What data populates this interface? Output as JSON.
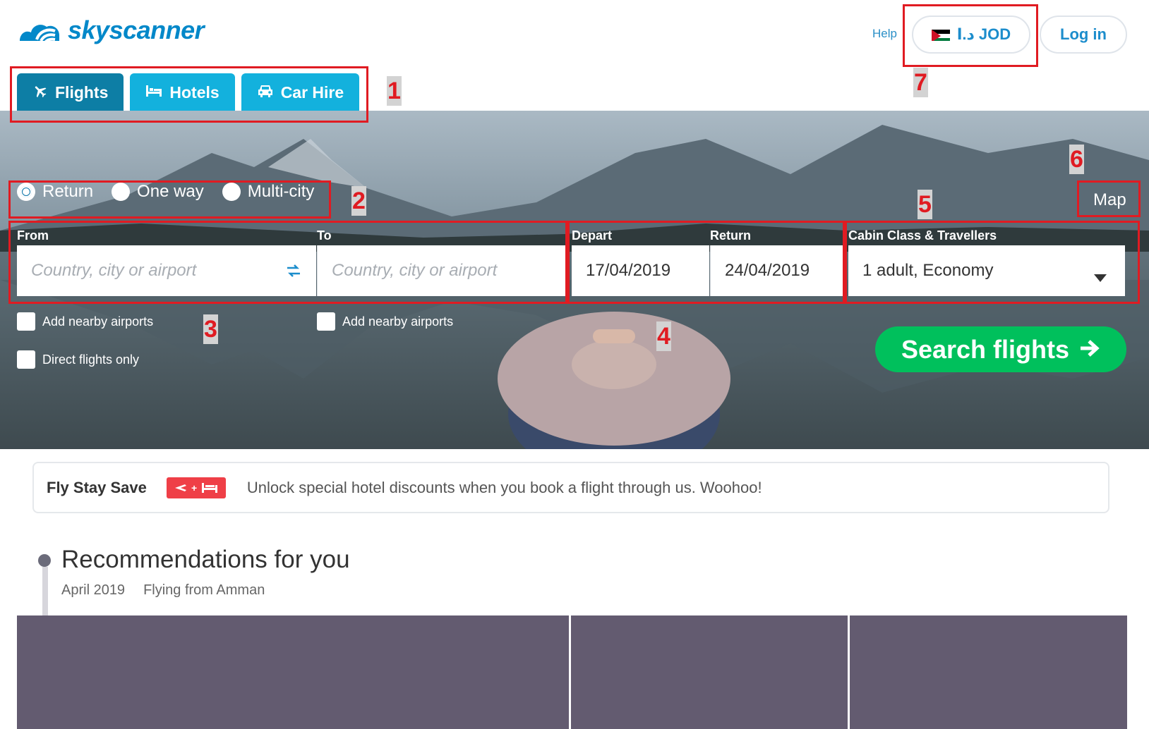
{
  "header": {
    "logo_text": "skyscanner",
    "help_label": "Help",
    "currency_label": "د.ا JOD",
    "login_label": "Log in"
  },
  "tabs": [
    {
      "label": "Flights",
      "icon": "plane-icon",
      "active": true
    },
    {
      "label": "Hotels",
      "icon": "bed-icon",
      "active": false
    },
    {
      "label": "Car Hire",
      "icon": "car-icon",
      "active": false
    }
  ],
  "trip_type": [
    {
      "label": "Return",
      "checked": true
    },
    {
      "label": "One way",
      "checked": false
    },
    {
      "label": "Multi-city",
      "checked": false
    }
  ],
  "map_label": "Map",
  "search_form": {
    "from_label": "From",
    "from_placeholder": "Country, city or airport",
    "to_label": "To",
    "to_placeholder": "Country, city or airport",
    "depart_label": "Depart",
    "depart_value": "17/04/2019",
    "return_label": "Return",
    "return_value": "24/04/2019",
    "cabin_label": "Cabin Class & Travellers",
    "cabin_value": "1 adult, Economy",
    "add_nearby_from": "Add nearby airports",
    "add_nearby_to": "Add nearby airports",
    "direct_only": "Direct flights only",
    "search_button": "Search flights"
  },
  "annotations": [
    "1",
    "2",
    "3",
    "4",
    "5",
    "6",
    "7"
  ],
  "promo": {
    "title": "Fly Stay Save",
    "text": "Unlock special hotel discounts when you book a flight through us. Woohoo!"
  },
  "recommendations": {
    "title": "Recommendations for you",
    "month": "April 2019",
    "origin": "Flying from Amman"
  },
  "colors": {
    "brand": "#0288c9",
    "tab_active": "#0d7ea5",
    "tab_inactive": "#13b1dd",
    "search_button": "#00c05c",
    "annotation": "#e01b22",
    "card": "#635b70"
  }
}
